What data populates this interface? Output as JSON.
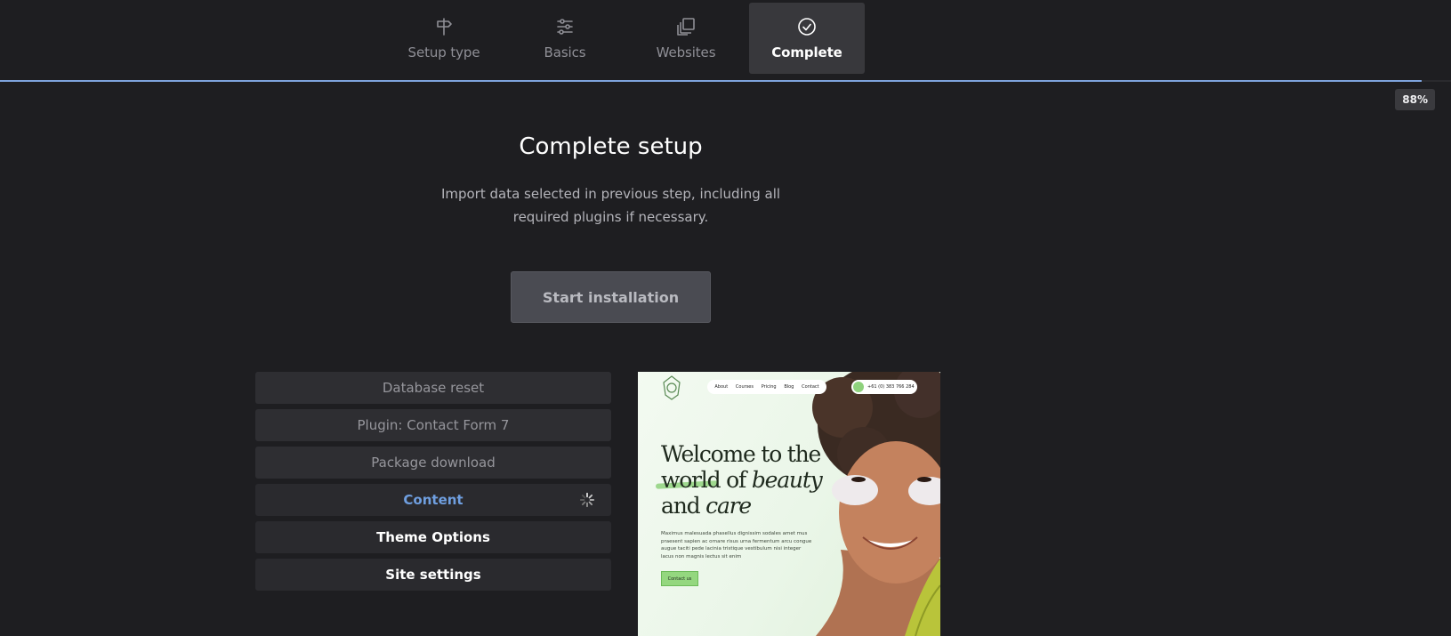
{
  "steps": [
    {
      "label": "Setup type",
      "icon": "signpost-icon",
      "active": false
    },
    {
      "label": "Basics",
      "icon": "sliders-icon",
      "active": false
    },
    {
      "label": "Websites",
      "icon": "copy-icon",
      "active": false
    },
    {
      "label": "Complete",
      "icon": "check-circle-icon",
      "active": true
    }
  ],
  "progress": {
    "percent": 98,
    "label": "88%"
  },
  "main": {
    "title": "Complete setup",
    "subtitle": "Import data selected in previous step, including all required plugins if necessary.",
    "start_button": "Start installation"
  },
  "tasks": [
    {
      "label": "Database reset",
      "state": "done"
    },
    {
      "label": "Plugin: Contact Form 7",
      "state": "done"
    },
    {
      "label": "Package download",
      "state": "done"
    },
    {
      "label": "Content",
      "state": "active"
    },
    {
      "label": "Theme Options",
      "state": "pending"
    },
    {
      "label": "Site settings",
      "state": "pending"
    }
  ],
  "preview": {
    "nav": [
      "About",
      "Courses",
      "Pricing",
      "Blog",
      "Contact"
    ],
    "phone": "+61 (0) 383 766 284",
    "heading_l1": "Welcome to the",
    "heading_l2a": "world of ",
    "heading_l2b": "beauty",
    "heading_l3a": "and ",
    "heading_l3b": "care",
    "body": "Maximus malesuada phasellus dignissim sodales amet mus praesent sapien ac ornare risus urna fermentum arcu congue augue taciti pede lacinia tristique vestibulum nisi integer lacus non magnis lectus sit enim",
    "cta": "Contact us"
  },
  "colors": {
    "accent": "#7ea3dc",
    "active_task": "#6f9fe0",
    "background": "#1e1e21"
  }
}
